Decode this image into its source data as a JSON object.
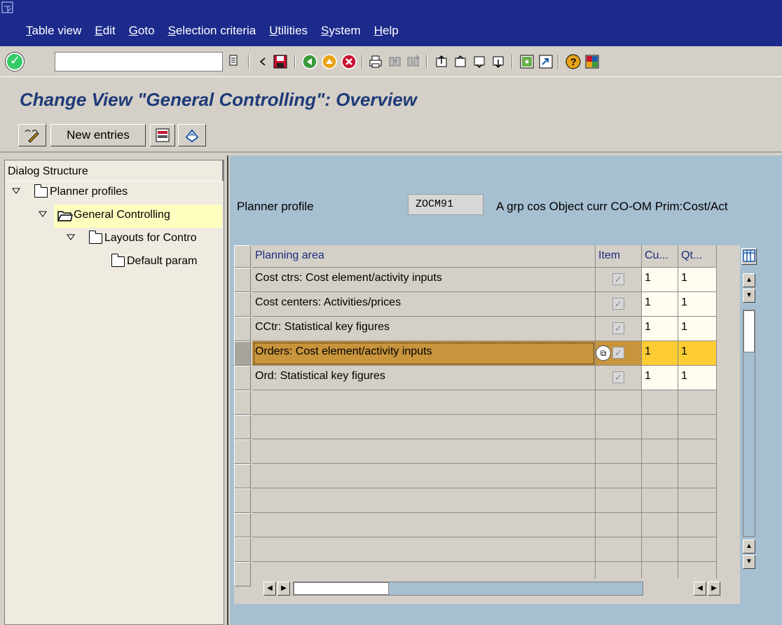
{
  "menu": {
    "items": [
      "Table view",
      "Edit",
      "Goto",
      "Selection criteria",
      "Utilities",
      "System",
      "Help"
    ]
  },
  "toolbar": {
    "command_field_value": "",
    "icons": [
      "enter-icon",
      "save-icon",
      "back-icon",
      "exit-icon",
      "cancel-icon",
      "print-icon",
      "find-icon",
      "find-next-icon",
      "first-page-icon",
      "previous-page-icon",
      "next-page-icon",
      "last-page-icon",
      "create-session-icon",
      "shortcut-icon",
      "help-icon",
      "customize-layout-icon"
    ]
  },
  "title": "Change View \"General Controlling\": Overview",
  "app_toolbar": {
    "new_entries_label": "New entries"
  },
  "dialog_structure": {
    "header": "Dialog Structure",
    "nodes": [
      {
        "label": "Planner profiles",
        "level": 0,
        "expanded": true
      },
      {
        "label": "General Controlling",
        "level": 1,
        "expanded": true,
        "selected": true
      },
      {
        "label": "Layouts for Contro",
        "level": 2,
        "expanded": true
      },
      {
        "label": "Default param",
        "level": 3
      }
    ]
  },
  "planner_profile": {
    "label": "Planner profile",
    "value": "ZOCM91",
    "description": "A grp cos Object curr CO-OM Prim:Cost/Act"
  },
  "table": {
    "headers": {
      "planning_area": "Planning area",
      "item": "Item",
      "cu": "Cu...",
      "qt": "Qt..."
    },
    "rows": [
      {
        "planning_area": "Cost ctrs: Cost element/activity inputs",
        "item": "✓",
        "cu": "1",
        "qt": "1"
      },
      {
        "planning_area": "Cost centers: Activities/prices",
        "item": "✓",
        "cu": "1",
        "qt": "1"
      },
      {
        "planning_area": "CCtr: Statistical key figures",
        "item": "✓",
        "cu": "1",
        "qt": "1"
      },
      {
        "planning_area": "Orders: Cost element/activity inputs",
        "item": "✓",
        "cu": "1",
        "qt": "1"
      },
      {
        "planning_area": "Ord: Statistical key figures",
        "item": "✓",
        "cu": "1",
        "qt": "1"
      }
    ],
    "selected_row": 3,
    "empty_rows": 8
  },
  "colors": {
    "menubar": "#1c2a8c",
    "title": "#1e3a78",
    "content_bg": "#a6bfd1",
    "selected_row": "#c8943c",
    "selected_cell": "#ffcc33",
    "tree_selected": "#ffffc0"
  }
}
